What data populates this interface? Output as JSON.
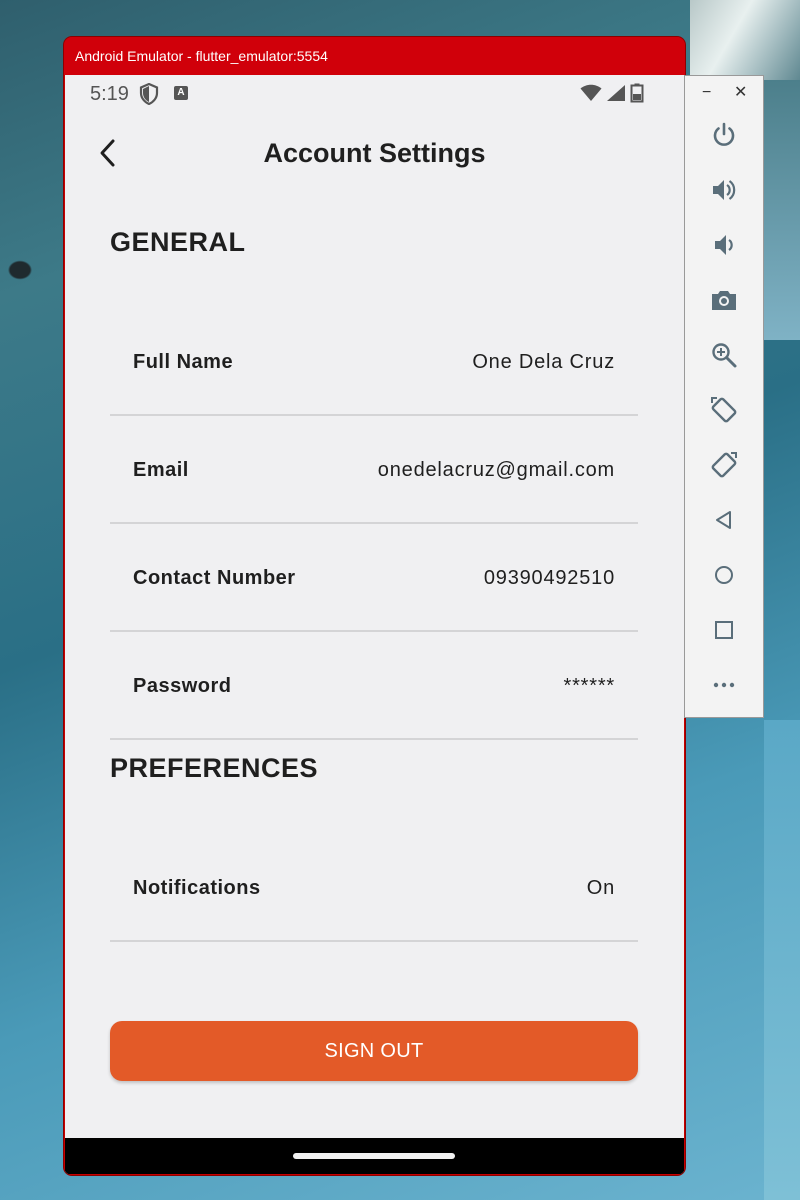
{
  "window": {
    "title": "Android Emulator - flutter_emulator:5554"
  },
  "status_bar": {
    "time": "5:19",
    "app_badge": "A"
  },
  "app_bar": {
    "title": "Account Settings"
  },
  "general": {
    "heading": "GENERAL",
    "rows": [
      {
        "label": "Full Name",
        "value": "One Dela Cruz"
      },
      {
        "label": "Email",
        "value": "onedelacruz@gmail.com"
      },
      {
        "label": "Contact Number",
        "value": "09390492510"
      },
      {
        "label": "Password",
        "value": "******"
      }
    ]
  },
  "preferences": {
    "heading": "PREFERENCES",
    "rows": [
      {
        "label": "Notifications",
        "value": "On"
      }
    ]
  },
  "sign_out": {
    "label": "SIGN OUT",
    "color": "#e35a28"
  },
  "toolbar": {
    "minimize": "−",
    "close": "✕",
    "buttons": [
      "power-icon",
      "volume-up-icon",
      "volume-down-icon",
      "camera-icon",
      "zoom-icon",
      "rotate-left-icon",
      "rotate-right-icon",
      "back-icon",
      "home-icon",
      "overview-icon",
      "more-icon"
    ]
  },
  "colors": {
    "title_bar": "#d0000a",
    "accent": "#e35a28",
    "background": "#f0f0f2"
  }
}
